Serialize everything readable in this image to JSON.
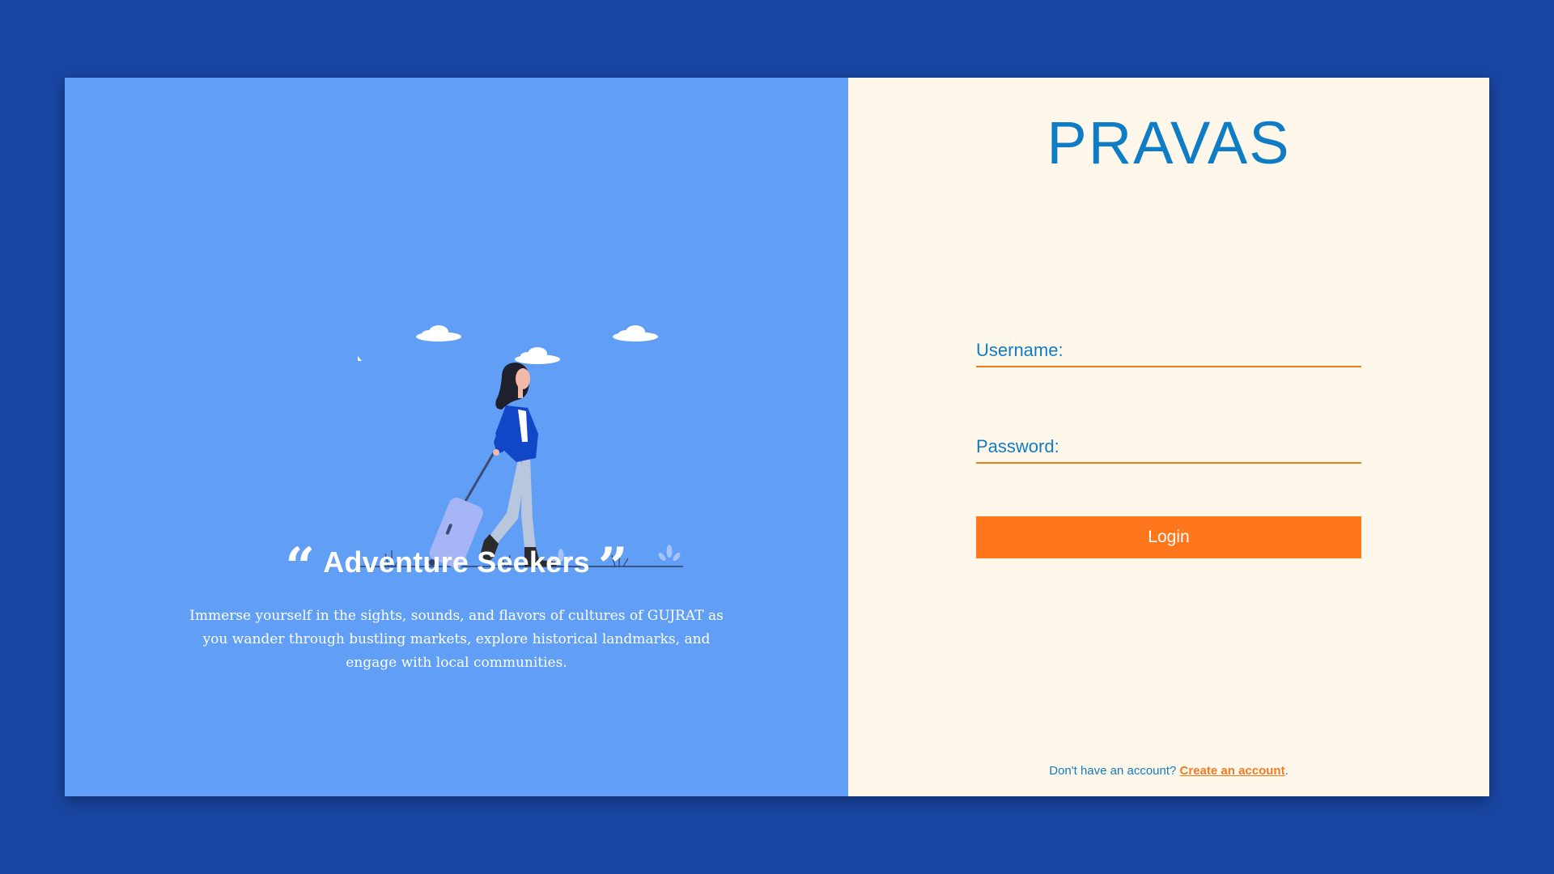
{
  "brand": {
    "name": "PRAVAS"
  },
  "hero": {
    "title": "Adventure Seekers",
    "open_quote": "“",
    "close_quote": "”",
    "description": "Immerse yourself in the sights, sounds, and flavors of cultures of GUJRAT as you wander through bustling markets, explore historical landmarks, and engage with local communities."
  },
  "form": {
    "username_label": "Username:",
    "username_value": "",
    "password_label": "Password:",
    "password_value": "",
    "login_label": "Login"
  },
  "signup": {
    "prompt": "Don't have an account? ",
    "link_label": "Create an account",
    "suffix": "."
  },
  "colors": {
    "page_background": "#1946a3",
    "left_panel": "#619ef5",
    "right_panel": "#fff8ea",
    "brand_blue": "#0f7dc6",
    "accent_orange": "#ff771d"
  },
  "icons": {
    "illustration": "traveler-with-suitcase-illustration"
  }
}
